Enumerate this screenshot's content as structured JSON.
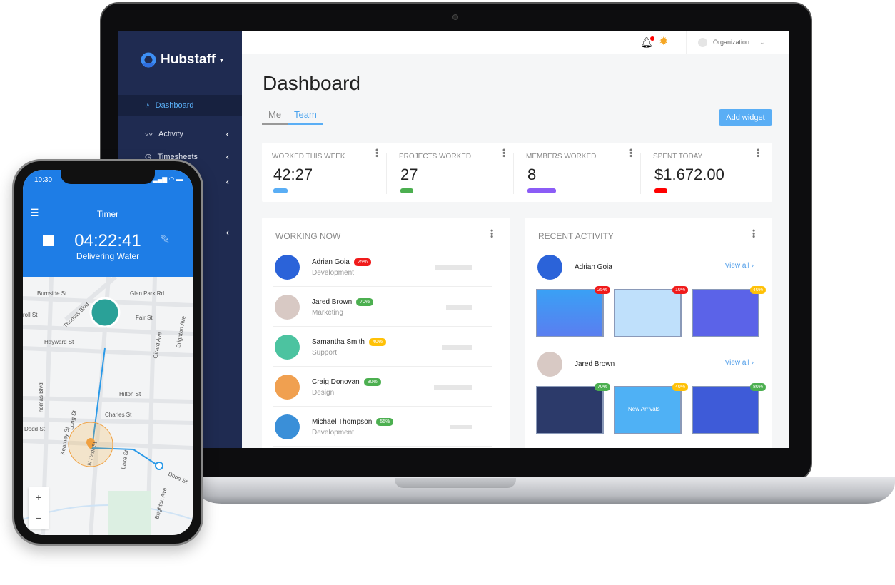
{
  "app": {
    "brand": "Hubstaff"
  },
  "sidebar": {
    "items": [
      {
        "label": "Dashboard",
        "icon": "dashboard-icon",
        "active": true
      },
      {
        "label": "Activity",
        "icon": "activity-icon"
      },
      {
        "label": "Timesheets",
        "icon": "clock-icon"
      }
    ]
  },
  "header": {
    "organization": "Organization"
  },
  "main": {
    "title": "Dashboard",
    "tabs": [
      {
        "label": "Me"
      },
      {
        "label": "Team",
        "active": true
      }
    ],
    "add_widget": "Add widget",
    "stats": [
      {
        "label": "WORKED THIS WEEK",
        "value": "42:27",
        "color": "#5aaef5"
      },
      {
        "label": "PROJECTS WORKED",
        "value": "27",
        "color": "#4caf50"
      },
      {
        "label": "MEMBERS WORKED",
        "value": "8",
        "color": "#8b5cf6"
      },
      {
        "label": "SPENT TODAY",
        "value": "$1.672.00",
        "color": "#f00"
      }
    ],
    "working_now": {
      "title": "WORKING NOW",
      "rows": [
        {
          "name": "Adrian Goia",
          "dept": "Development",
          "pct": "25%",
          "color": "#f01b1b"
        },
        {
          "name": "Jared Brown",
          "dept": "Marketing",
          "pct": "70%",
          "color": "#4caf50"
        },
        {
          "name": "Samantha Smith",
          "dept": "Support",
          "pct": "40%",
          "color": "#ffc107"
        },
        {
          "name": "Craig Donovan",
          "dept": "Design",
          "pct": "80%",
          "color": "#4caf50"
        },
        {
          "name": "Michael Thompson",
          "dept": "Development",
          "pct": "55%",
          "color": "#4caf50"
        }
      ]
    },
    "recent_activity": {
      "title": "RECENT ACTIVITY",
      "view_all": "View all",
      "users": [
        {
          "name": "Adrian Goia",
          "shots": [
            {
              "pct": "25%",
              "color": "#f01b1b"
            },
            {
              "pct": "10%",
              "color": "#f01b1b"
            },
            {
              "pct": "40%",
              "color": "#ffc107"
            }
          ]
        },
        {
          "name": "Jared Brown",
          "shots": [
            {
              "pct": "70%",
              "color": "#4caf50"
            },
            {
              "pct": "40%",
              "color": "#ffc107"
            },
            {
              "pct": "80%",
              "color": "#4caf50"
            }
          ],
          "shot_text": "New Arrivals"
        }
      ]
    }
  },
  "phone": {
    "time": "10:30",
    "title": "Timer",
    "timer": "04:22:41",
    "task": "Delivering Water",
    "streets": [
      "Burnside St",
      "Glen Park Rd",
      "Thomas Blvd",
      "Fair St",
      "Hayward St",
      "Girard Ave",
      "Brighton Ave",
      "Thomas Blvd",
      "Hilton St",
      "Charles St",
      "Dodd St",
      "Long St",
      "Kearney St",
      "N Park St",
      "Lake St",
      "Dodd St",
      "Brighton Ave",
      "roll St"
    ],
    "zoom_in": "+",
    "zoom_out": "−"
  }
}
